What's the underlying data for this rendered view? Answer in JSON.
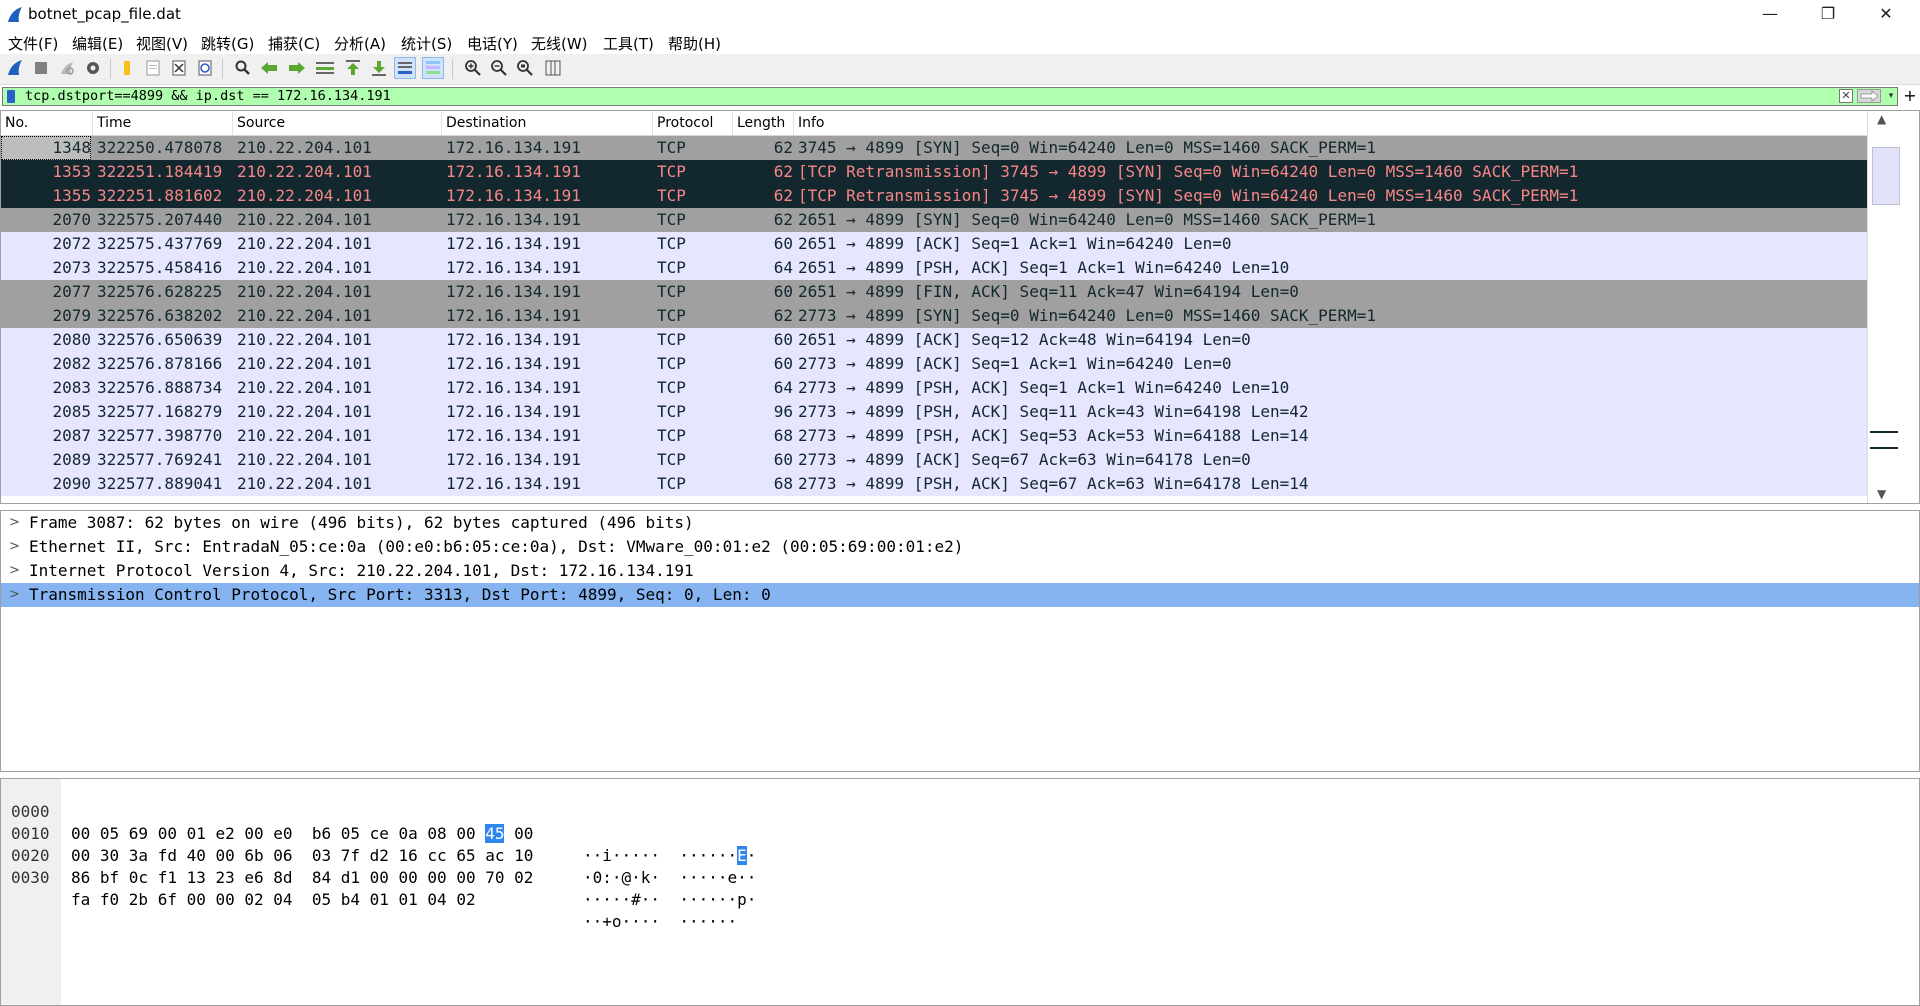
{
  "window": {
    "title": "botnet_pcap_file.dat",
    "minimize_glyph": "—",
    "maximize_glyph": "❐",
    "close_glyph": "✕"
  },
  "menu": [
    "文件(F)",
    "编辑(E)",
    "视图(V)",
    "跳转(G)",
    "捕获(C)",
    "分析(A)",
    "统计(S)",
    "电话(Y)",
    "无线(W)",
    "工具(T)",
    "帮助(H)"
  ],
  "toolbar": {
    "icons": [
      "shark-fin-start-icon",
      "stop-icon",
      "restart-icon",
      "options-gear-icon",
      "open-folder-icon",
      "save-file-icon",
      "close-file-icon",
      "reload-icon",
      "find-icon",
      "go-back-icon",
      "go-forward-icon",
      "go-to-packet-icon",
      "go-first-icon",
      "go-last-icon",
      "autoscroll-icon",
      "colorize-icon",
      "zoom-in-icon",
      "zoom-out-icon",
      "zoom-reset-icon",
      "resize-columns-icon"
    ]
  },
  "filter": {
    "value": "tcp.dstport==4899 && ip.dst == 172.16.134.191",
    "add_glyph": "+"
  },
  "packet_list": {
    "columns": [
      "No.",
      "Time",
      "Source",
      "Destination",
      "Protocol",
      "Length",
      "Info"
    ],
    "rows": [
      {
        "no": "1348",
        "time": "322250.478078",
        "src": "210.22.204.101",
        "dst": "172.16.134.191",
        "proto": "TCP",
        "len": "62",
        "info": "3745 → 4899 [SYN] Seq=0 Win=64240 Len=0 MSS=1460 SACK_PERM=1",
        "style": "gray"
      },
      {
        "no": "1353",
        "time": "322251.184419",
        "src": "210.22.204.101",
        "dst": "172.16.134.191",
        "proto": "TCP",
        "len": "62",
        "info": "[TCP Retransmission] 3745 → 4899 [SYN] Seq=0 Win=64240 Len=0 MSS=1460 SACK_PERM=1",
        "style": "dark"
      },
      {
        "no": "1355",
        "time": "322251.881602",
        "src": "210.22.204.101",
        "dst": "172.16.134.191",
        "proto": "TCP",
        "len": "62",
        "info": "[TCP Retransmission] 3745 → 4899 [SYN] Seq=0 Win=64240 Len=0 MSS=1460 SACK_PERM=1",
        "style": "dark"
      },
      {
        "no": "2070",
        "time": "322575.207440",
        "src": "210.22.204.101",
        "dst": "172.16.134.191",
        "proto": "TCP",
        "len": "62",
        "info": "2651 → 4899 [SYN] Seq=0 Win=64240 Len=0 MSS=1460 SACK_PERM=1",
        "style": "gray"
      },
      {
        "no": "2072",
        "time": "322575.437769",
        "src": "210.22.204.101",
        "dst": "172.16.134.191",
        "proto": "TCP",
        "len": "60",
        "info": "2651 → 4899 [ACK] Seq=1 Ack=1 Win=64240 Len=0",
        "style": "lav"
      },
      {
        "no": "2073",
        "time": "322575.458416",
        "src": "210.22.204.101",
        "dst": "172.16.134.191",
        "proto": "TCP",
        "len": "64",
        "info": "2651 → 4899 [PSH, ACK] Seq=1 Ack=1 Win=64240 Len=10",
        "style": "lav"
      },
      {
        "no": "2077",
        "time": "322576.628225",
        "src": "210.22.204.101",
        "dst": "172.16.134.191",
        "proto": "TCP",
        "len": "60",
        "info": "2651 → 4899 [FIN, ACK] Seq=11 Ack=47 Win=64194 Len=0",
        "style": "gray"
      },
      {
        "no": "2079",
        "time": "322576.638202",
        "src": "210.22.204.101",
        "dst": "172.16.134.191",
        "proto": "TCP",
        "len": "62",
        "info": "2773 → 4899 [SYN] Seq=0 Win=64240 Len=0 MSS=1460 SACK_PERM=1",
        "style": "gray"
      },
      {
        "no": "2080",
        "time": "322576.650639",
        "src": "210.22.204.101",
        "dst": "172.16.134.191",
        "proto": "TCP",
        "len": "60",
        "info": "2651 → 4899 [ACK] Seq=12 Ack=48 Win=64194 Len=0",
        "style": "lav"
      },
      {
        "no": "2082",
        "time": "322576.878166",
        "src": "210.22.204.101",
        "dst": "172.16.134.191",
        "proto": "TCP",
        "len": "60",
        "info": "2773 → 4899 [ACK] Seq=1 Ack=1 Win=64240 Len=0",
        "style": "lav"
      },
      {
        "no": "2083",
        "time": "322576.888734",
        "src": "210.22.204.101",
        "dst": "172.16.134.191",
        "proto": "TCP",
        "len": "64",
        "info": "2773 → 4899 [PSH, ACK] Seq=1 Ack=1 Win=64240 Len=10",
        "style": "lav"
      },
      {
        "no": "2085",
        "time": "322577.168279",
        "src": "210.22.204.101",
        "dst": "172.16.134.191",
        "proto": "TCP",
        "len": "96",
        "info": "2773 → 4899 [PSH, ACK] Seq=11 Ack=43 Win=64198 Len=42",
        "style": "lav"
      },
      {
        "no": "2087",
        "time": "322577.398770",
        "src": "210.22.204.101",
        "dst": "172.16.134.191",
        "proto": "TCP",
        "len": "68",
        "info": "2773 → 4899 [PSH, ACK] Seq=53 Ack=53 Win=64188 Len=14",
        "style": "lav"
      },
      {
        "no": "2089",
        "time": "322577.769241",
        "src": "210.22.204.101",
        "dst": "172.16.134.191",
        "proto": "TCP",
        "len": "60",
        "info": "2773 → 4899 [ACK] Seq=67 Ack=63 Win=64178 Len=0",
        "style": "lav"
      },
      {
        "no": "2090",
        "time": "322577.889041",
        "src": "210.22.204.101",
        "dst": "172.16.134.191",
        "proto": "TCP",
        "len": "68",
        "info": "2773 → 4899 [PSH, ACK] Seq=67 Ack=63 Win=64178 Len=14",
        "style": "lav"
      }
    ],
    "row_colors": {
      "gray": "#a0a0a0",
      "dark": "#12272e",
      "lav": "#e7e6ff"
    }
  },
  "details": {
    "rows": [
      {
        "text": "Frame 3087: 62 bytes on wire (496 bits), 62 bytes captured (496 bits)",
        "selected": false
      },
      {
        "text": "Ethernet II, Src: EntradaN_05:ce:0a (00:e0:b6:05:ce:0a), Dst: VMware_00:01:e2 (00:05:69:00:01:e2)",
        "selected": false
      },
      {
        "text": "Internet Protocol Version 4, Src: 210.22.204.101, Dst: 172.16.134.191",
        "selected": false
      },
      {
        "text": "Transmission Control Protocol, Src Port: 3313, Dst Port: 4899, Seq: 0, Len: 0",
        "selected": true
      }
    ],
    "selected_color": "#86b4f0"
  },
  "bytes": {
    "rows": [
      {
        "offset": "0000",
        "hex_a": "00 05 69 00 01 e2 00 e0  b6 05 ce 0a 08 00 ",
        "hex_hl": "45",
        "hex_b": " 00",
        "ascii_a": "··i·····  ······",
        "ascii_hl": "E",
        "ascii_b": "·"
      },
      {
        "offset": "0010",
        "hex_a": "00 30 3a fd 40 00 6b 06  03 7f d2 16 cc 65 ac 10",
        "hex_hl": "",
        "hex_b": "",
        "ascii_a": "·0:·@·k·  ·····e··",
        "ascii_hl": "",
        "ascii_b": ""
      },
      {
        "offset": "0020",
        "hex_a": "86 bf 0c f1 13 23 e6 8d  84 d1 00 00 00 00 70 02",
        "hex_hl": "",
        "hex_b": "",
        "ascii_a": "·····#··  ······p·",
        "ascii_hl": "",
        "ascii_b": ""
      },
      {
        "offset": "0030",
        "hex_a": "fa f0 2b 6f 00 00 02 04  05 b4 01 01 04 02",
        "hex_hl": "",
        "hex_b": "",
        "ascii_a": "··+o····  ······",
        "ascii_hl": "",
        "ascii_b": ""
      }
    ],
    "highlight_color": "#2f86ec"
  }
}
